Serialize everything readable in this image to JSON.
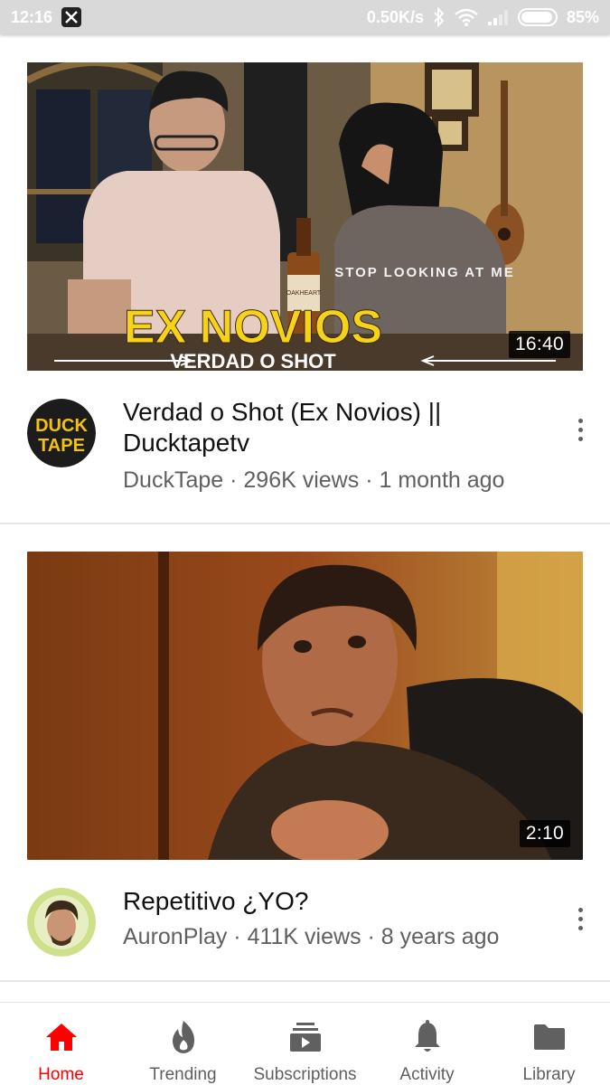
{
  "status_bar": {
    "time": "12:16",
    "network_speed": "0.50K/s",
    "battery": "85%",
    "icons": [
      "notification-tools-icon",
      "bluetooth-icon",
      "wifi-icon",
      "signal-icon",
      "battery-icon"
    ]
  },
  "videos": [
    {
      "title": "Verdad o Shot (Ex Novios) || Ducktapetv",
      "channel": "DuckTape",
      "views": "296K views",
      "age": "1 month ago",
      "duration": "16:40",
      "thumbnail": {
        "headline": "EX NOVIOS",
        "subline": "VERDAD O SHOT",
        "shirt_text": "STOP LOOKING AT ME",
        "bottle_label": "OAKHEART"
      },
      "avatar": {
        "line1": "DUCK",
        "line2": "TAPE"
      }
    },
    {
      "title": "Repetitivo ¿YO?",
      "channel": "AuronPlay",
      "views": "411K views",
      "age": "8 years ago",
      "duration": "2:10"
    }
  ],
  "byline_separator": " · ",
  "bottom_nav": [
    {
      "label": "Home",
      "icon": "home-icon",
      "active": true
    },
    {
      "label": "Trending",
      "icon": "flame-icon",
      "active": false
    },
    {
      "label": "Subscriptions",
      "icon": "subscriptions-icon",
      "active": false
    },
    {
      "label": "Activity",
      "icon": "bell-icon",
      "active": false
    },
    {
      "label": "Library",
      "icon": "folder-icon",
      "active": false
    }
  ],
  "colors": {
    "accent": "#ff0000",
    "text_secondary": "#606060",
    "headline_yellow": "#f6d21a",
    "avatar_yellow": "#f4c20d"
  }
}
